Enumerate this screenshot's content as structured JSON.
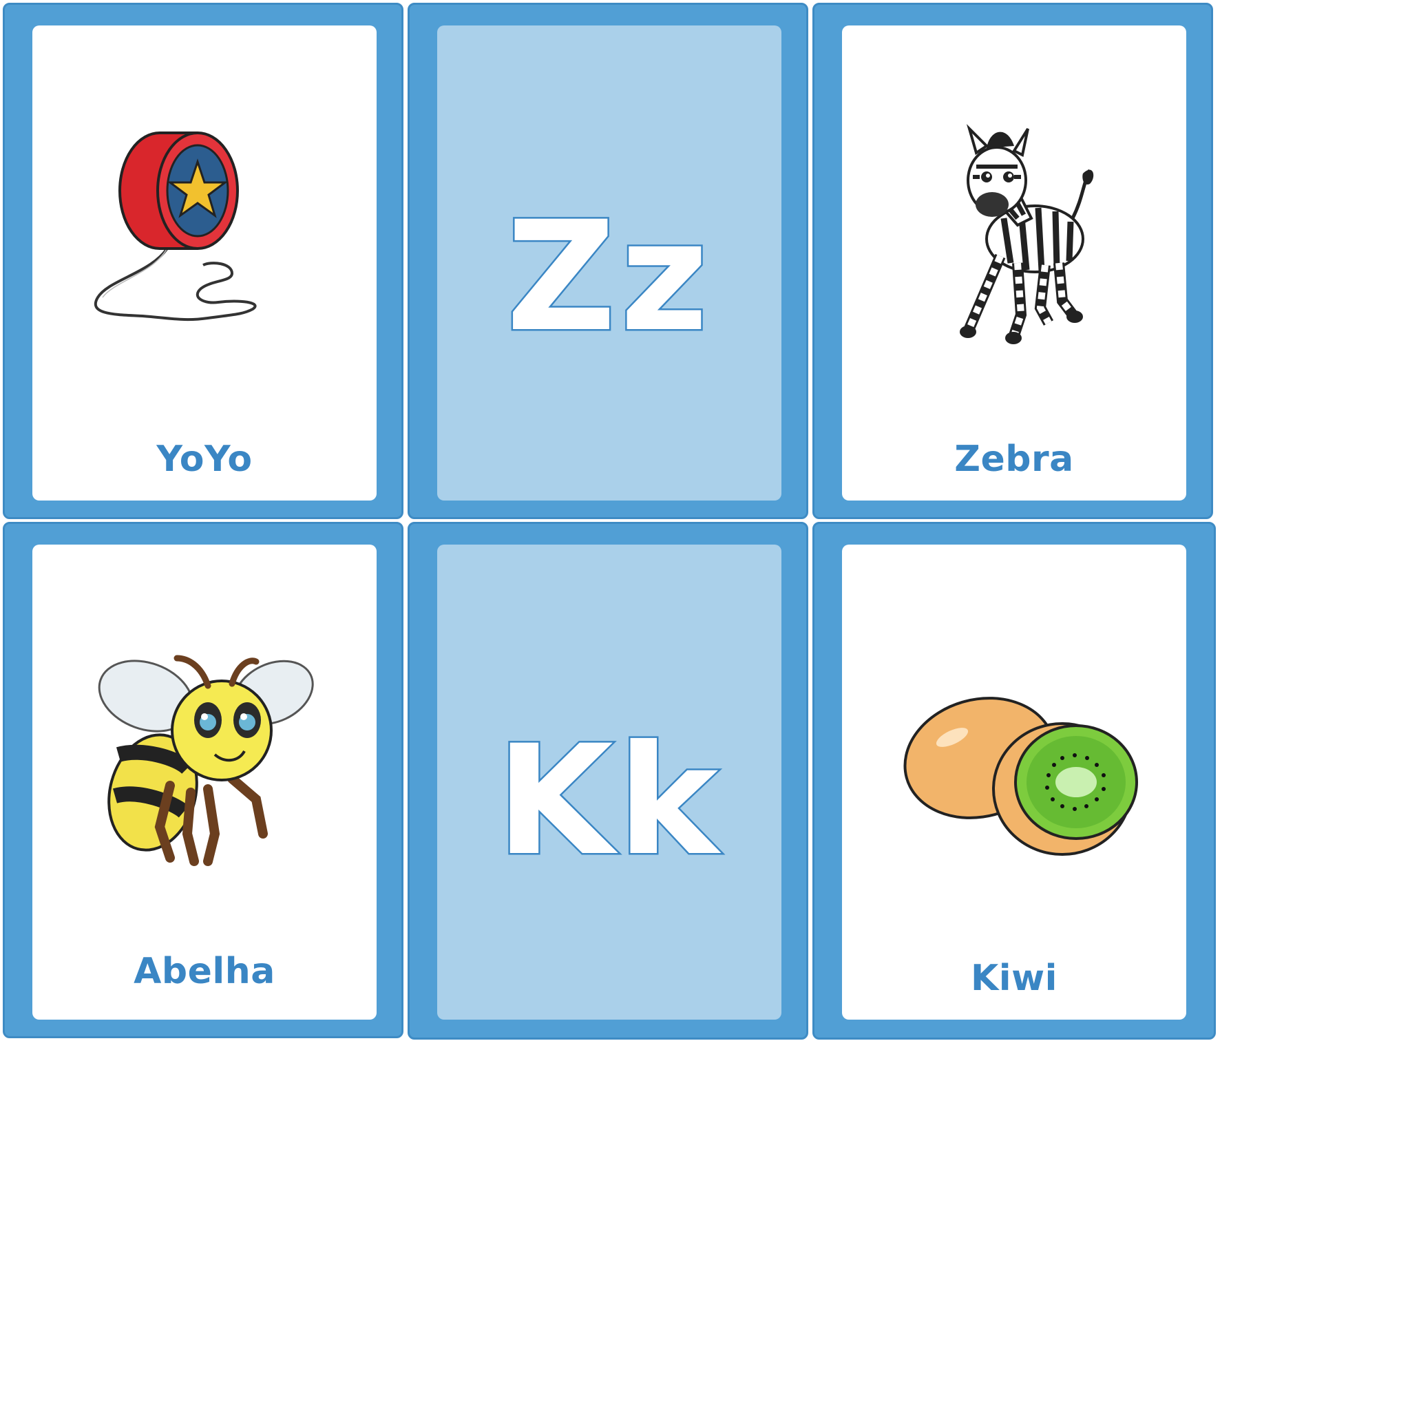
{
  "colors": {
    "card_frame": "#519fd5",
    "card_frame_border": "#3e8bc4",
    "card_face_picture": "#ffffff",
    "card_face_letter": "#aad0ea",
    "label_text": "#3a86c4"
  },
  "cards": [
    {
      "type": "picture",
      "word": "YoYo",
      "icon": "yoyo-icon"
    },
    {
      "type": "letter",
      "letters": "Zz"
    },
    {
      "type": "picture",
      "word": "Zebra",
      "icon": "zebra-icon"
    },
    {
      "type": "picture",
      "word": "Abelha",
      "icon": "bee-icon"
    },
    {
      "type": "letter",
      "letters": "Kk"
    },
    {
      "type": "picture",
      "word": "Kiwi",
      "icon": "kiwi-icon"
    }
  ]
}
